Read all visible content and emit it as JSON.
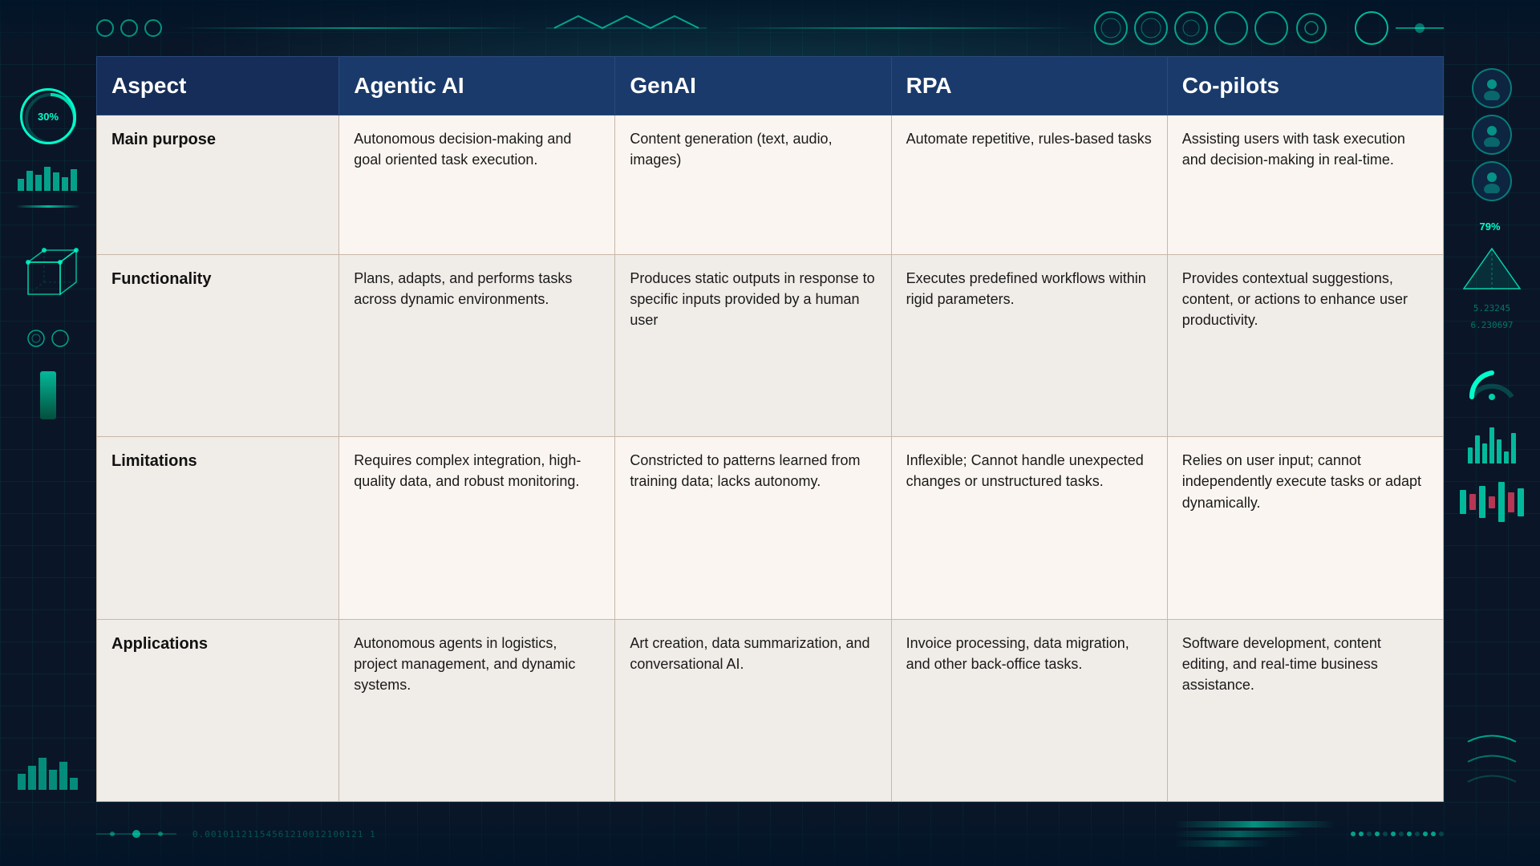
{
  "background": {
    "accent_color": "#00ffcc",
    "primary_dark": "#0a1628",
    "header_bg": "#1a3a6b"
  },
  "gauge": {
    "value": "30%"
  },
  "table": {
    "headers": [
      "Aspect",
      "Agentic AI",
      "GenAI",
      "RPA",
      "Co-pilots"
    ],
    "rows": [
      {
        "aspect": "Main purpose",
        "agentic_ai": "Autonomous decision-making and goal oriented task execution.",
        "genai": "Content generation (text, audio, images)",
        "rpa": "Automate repetitive, rules-based tasks",
        "copilots": "Assisting users with task execution and decision-making in real-time."
      },
      {
        "aspect": "Functionality",
        "agentic_ai": "Plans, adapts, and performs tasks across dynamic environments.",
        "genai": "Produces static outputs in response to specific inputs provided by a human user",
        "rpa": "Executes predefined workflows within rigid parameters.",
        "copilots": "Provides contextual suggestions, content, or actions to enhance user productivity."
      },
      {
        "aspect": "Limitations",
        "agentic_ai": "Requires complex integration, high-quality data, and robust monitoring.",
        "genai": "Constricted to patterns learned from training data; lacks autonomy.",
        "rpa": "Inflexible; Cannot handle unexpected changes or unstructured tasks.",
        "copilots": "Relies on user input; cannot independently execute tasks or adapt dynamically."
      },
      {
        "aspect": "Applications",
        "agentic_ai": "Autonomous agents in logistics, project management, and dynamic systems.",
        "genai": "Art creation, data summarization, and conversational AI.",
        "rpa": "Invoice processing, data migration, and other back-office tasks.",
        "copilots": "Software development, content editing, and real-time business assistance."
      }
    ]
  },
  "decorative": {
    "binary_text": "0.00101121154561210012100121 1",
    "percentage_right1": "79%",
    "percentage_right2": "5.23245",
    "percentage_right3": "6.230697"
  }
}
